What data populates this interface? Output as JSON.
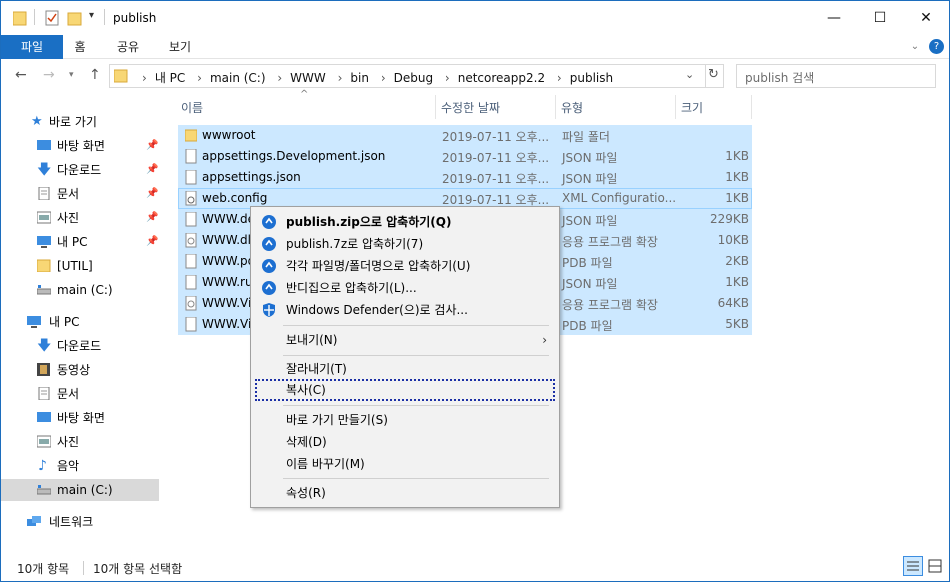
{
  "window": {
    "title": "publish",
    "controls": {
      "minimize": "—",
      "maximize": "☐",
      "close": "✕"
    }
  },
  "ribbon": {
    "tabs": [
      "파일",
      "홈",
      "공유",
      "보기"
    ],
    "expand_icon": "chevron-down",
    "help_icon": "?"
  },
  "nav": {
    "back": "←",
    "forward": "→",
    "up": "↑",
    "breadcrumb": [
      "내 PC",
      "main (C:)",
      "WWW",
      "bin",
      "Debug",
      "netcoreapp2.2",
      "publish"
    ],
    "search_placeholder": "publish 검색"
  },
  "sidebar": {
    "quick_access": "바로 가기",
    "quick_items": [
      "바탕 화면",
      "다운로드",
      "문서",
      "사진",
      "내 PC",
      "[UTIL]",
      "main (C:)"
    ],
    "this_pc": "내 PC",
    "pc_items": [
      "다운로드",
      "동영상",
      "문서",
      "바탕 화면",
      "사진",
      "음악",
      "main (C:)"
    ],
    "network": "네트워크"
  },
  "columns": {
    "name": "이름",
    "date": "수정한 날짜",
    "type": "유형",
    "size": "크기"
  },
  "files": [
    {
      "name": "wwwroot",
      "date": "2019-07-11 오후...",
      "type": "파일 폴더",
      "size": "",
      "kind": "folder"
    },
    {
      "name": "appsettings.Development.json",
      "date": "2019-07-11 오후...",
      "type": "JSON 파일",
      "size": "1KB",
      "kind": "file"
    },
    {
      "name": "appsettings.json",
      "date": "2019-07-11 오후...",
      "type": "JSON 파일",
      "size": "1KB",
      "kind": "file"
    },
    {
      "name": "web.config",
      "date": "2019-07-11 오후...",
      "type": "XML Configuratio...",
      "size": "1KB",
      "kind": "config"
    },
    {
      "name": "WWW.de",
      "date": "",
      "type": "JSON 파일",
      "size": "229KB",
      "kind": "file"
    },
    {
      "name": "WWW.dll",
      "date": "",
      "type": "응용 프로그램 확장",
      "size": "10KB",
      "kind": "dll"
    },
    {
      "name": "WWW.pd",
      "date": "",
      "type": "PDB 파일",
      "size": "2KB",
      "kind": "file"
    },
    {
      "name": "WWW.ru",
      "date": "",
      "type": "JSON 파일",
      "size": "1KB",
      "kind": "file"
    },
    {
      "name": "WWW.Vi",
      "date": "",
      "type": "응용 프로그램 확장",
      "size": "64KB",
      "kind": "dll"
    },
    {
      "name": "WWW.Vi",
      "date": "",
      "type": "PDB 파일",
      "size": "5KB",
      "kind": "file"
    }
  ],
  "context_menu": {
    "items": [
      {
        "label": "publish.zip으로 압축하기(Q)",
        "icon": "bandizip-icon",
        "bold": true
      },
      {
        "label": "publish.7z로 압축하기(7)",
        "icon": "bandizip-icon"
      },
      {
        "label": "각각 파일명/폴더명으로 압축하기(U)",
        "icon": "bandizip-icon"
      },
      {
        "label": "반디집으로 압축하기(L)...",
        "icon": "bandizip-icon"
      },
      {
        "label": "Windows Defender(으)로 검사...",
        "icon": "defender-shield-icon"
      },
      {
        "label": "보내기(N)",
        "submenu": true
      },
      {
        "label": "잘라내기(T)"
      },
      {
        "label": "복사(C)",
        "focused": true
      },
      {
        "label": "바로 가기 만들기(S)"
      },
      {
        "label": "삭제(D)"
      },
      {
        "label": "이름 바꾸기(M)"
      },
      {
        "label": "속성(R)"
      }
    ]
  },
  "status": {
    "count": "10개 항목",
    "selected": "10개 항목 선택함"
  }
}
